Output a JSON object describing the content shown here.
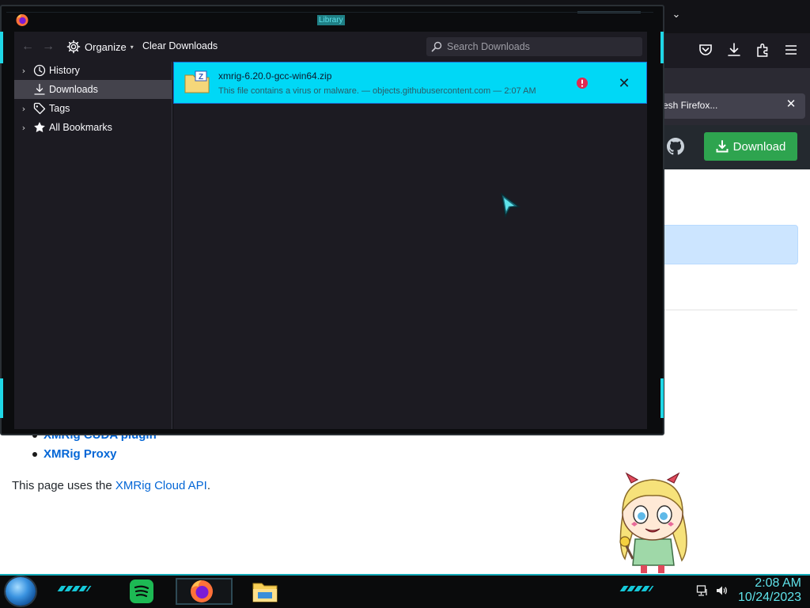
{
  "browser": {
    "notice_text": "resh Firefox...",
    "notice_close": "✕",
    "download_button_label": "Download",
    "tab_menu_chevron": "⌄"
  },
  "page": {
    "list_items": [
      "XMRig CUDA plugin",
      "XMRig Proxy"
    ],
    "footer_before": "This page uses the ",
    "footer_link": "XMRig Cloud API",
    "footer_after": "."
  },
  "library": {
    "window_title": "Library",
    "toolbar": {
      "back_icon": "←",
      "forward_icon": "→",
      "organize_label": "Organize",
      "organize_caret": "▾",
      "clear_label": "Clear Downloads",
      "search_placeholder": "Search Downloads"
    },
    "sidebar": [
      {
        "label": "History",
        "icon": "clock-icon",
        "twisty": "›"
      },
      {
        "label": "Downloads",
        "icon": "download-icon",
        "twisty": ""
      },
      {
        "label": "Tags",
        "icon": "tag-icon",
        "twisty": "›"
      },
      {
        "label": "All Bookmarks",
        "icon": "star-icon",
        "twisty": "›"
      }
    ],
    "download": {
      "filename": "xmrig-6.20.0-gcc-win64.zip",
      "status": "This file contains a virus or malware. — objects.githubusercontent.com — 2:07 AM",
      "close": "✕"
    }
  },
  "taskbar": {
    "time": "2:08 AM",
    "date": "10/24/2023"
  },
  "colors": {
    "accent_cyan": "#1fd7e6",
    "download_row_bg": "#00d8f6",
    "github_green": "#2ea44f",
    "link_blue": "#0366d6",
    "malware_red": "#e22850"
  }
}
